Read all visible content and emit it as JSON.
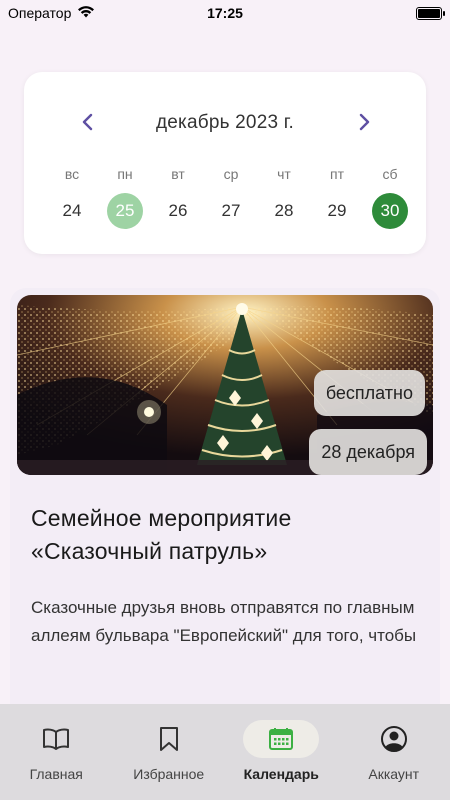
{
  "status_bar": {
    "carrier": "Оператор",
    "time": "17:25"
  },
  "calendar": {
    "month_title": "декабрь 2023 г.",
    "weekdays": [
      "вс",
      "пн",
      "вт",
      "ср",
      "чт",
      "пт",
      "сб"
    ],
    "days": [
      "24",
      "25",
      "26",
      "27",
      "28",
      "29",
      "30"
    ],
    "today_index": 1,
    "selected_index": 6,
    "colors": {
      "today": "#9ed3a4",
      "selected": "#2e8b3a",
      "nav_arrow": "#5e4fa2"
    }
  },
  "event": {
    "price_badge": "бесплатно",
    "date_badge": "28 декабря",
    "title": "Семейное мероприятие «Сказочный патруль»",
    "description": "Сказочные друзья вновь отправятся по главным аллеям бульвара \"Европейский\" для того, чтобы",
    "image_icon": "christmas-tree-lights-photo"
  },
  "bottom_nav": {
    "items": [
      {
        "label": "Главная",
        "icon": "book-icon"
      },
      {
        "label": "Избранное",
        "icon": "bookmark-icon"
      },
      {
        "label": "Календарь",
        "icon": "calendar-icon"
      },
      {
        "label": "Аккаунт",
        "icon": "account-icon"
      }
    ],
    "active_index": 2,
    "active_color": "#3cb043"
  }
}
